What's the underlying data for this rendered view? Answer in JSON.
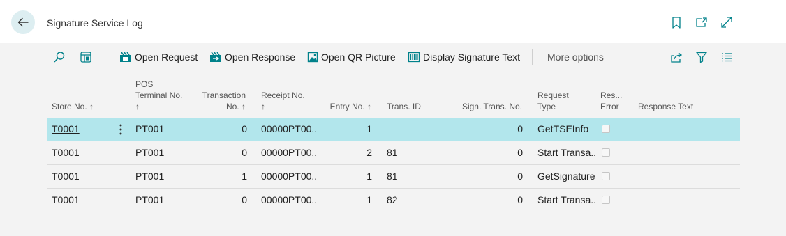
{
  "header": {
    "title": "Signature Service Log",
    "back_icon": "arrow-left-icon",
    "bookmark_icon": "bookmark-icon",
    "open_new_icon": "open-in-new-window-icon",
    "expand_icon": "expand-icon"
  },
  "actions": {
    "search_icon": "search-icon",
    "edit_list_icon": "edit-list-icon",
    "open_request": "Open Request",
    "open_response": "Open Response",
    "open_qr_picture": "Open QR Picture",
    "display_signature_text": "Display Signature Text",
    "more_options": "More options",
    "share_icon": "share-icon",
    "filter_icon": "filter-icon",
    "list_view_icon": "list-view-icon"
  },
  "columns": {
    "store_no": "Store No.",
    "pos_terminal_1": "POS",
    "pos_terminal_2": "Terminal No.",
    "transaction_1": "Transaction",
    "transaction_2": "No.",
    "receipt_no": "Receipt No.",
    "entry_no": "Entry No.",
    "trans_id": "Trans. ID",
    "sign_trans_no": "Sign. Trans. No.",
    "request_type_1": "Request",
    "request_type_2": "Type",
    "res_error_1": "Res...",
    "res_error_2": "Error",
    "response_text": "Response Text",
    "sort_arrow": "↑"
  },
  "rows": [
    {
      "store_no": "T0001",
      "pos_terminal_no": "PT001",
      "transaction_no": "0",
      "receipt_no": "00000PT00...",
      "entry_no": "1",
      "trans_id": "",
      "sign_trans_no": "0",
      "request_type": "GetTSEInfo",
      "res_error": false,
      "response_text": ""
    },
    {
      "store_no": "T0001",
      "pos_terminal_no": "PT001",
      "transaction_no": "0",
      "receipt_no": "00000PT00...",
      "entry_no": "2",
      "trans_id": "81",
      "sign_trans_no": "0",
      "request_type": "Start Transa...",
      "res_error": false,
      "response_text": ""
    },
    {
      "store_no": "T0001",
      "pos_terminal_no": "PT001",
      "transaction_no": "1",
      "receipt_no": "00000PT00...",
      "entry_no": "1",
      "trans_id": "81",
      "sign_trans_no": "0",
      "request_type": "GetSignature",
      "res_error": false,
      "response_text": ""
    },
    {
      "store_no": "T0001",
      "pos_terminal_no": "PT001",
      "transaction_no": "0",
      "receipt_no": "00000PT00...",
      "entry_no": "1",
      "trans_id": "82",
      "sign_trans_no": "0",
      "request_type": "Start Transa...",
      "res_error": false,
      "response_text": ""
    }
  ],
  "colors": {
    "accent": "#00818a",
    "selected_row": "#b2e6ec",
    "back_button_bg": "#ddeef1"
  }
}
